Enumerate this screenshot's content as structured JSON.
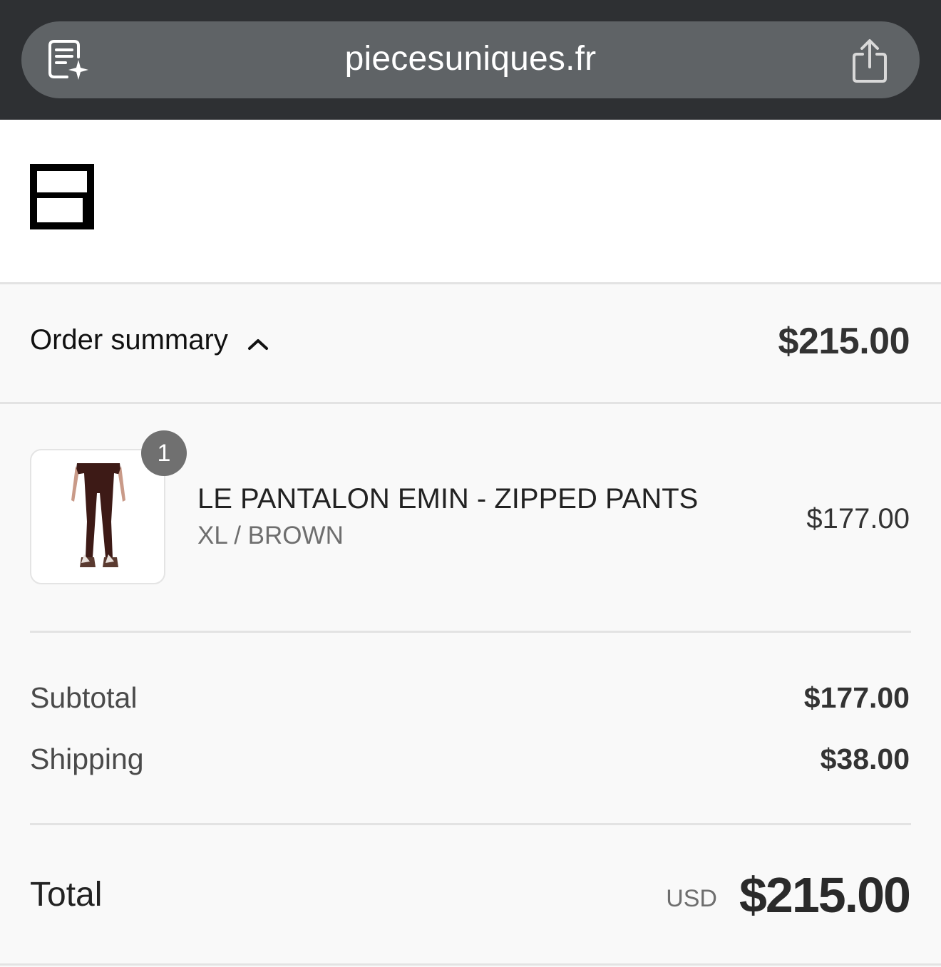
{
  "browser": {
    "url": "piecesuniques.fr",
    "reader_icon": "reader-sparkle-icon",
    "share_icon": "share-icon"
  },
  "store": {
    "logo": "store-logo"
  },
  "summary": {
    "label": "Order summary",
    "toggle_icon": "chevron-up-icon",
    "total": "$215.00"
  },
  "item": {
    "quantity": "1",
    "name": "LE PANTALON EMIN - ZIPPED PANTS",
    "variant": "XL / BROWN",
    "price": "$177.00",
    "image": "brown-pants-thumbnail"
  },
  "lines": [
    {
      "label": "Subtotal",
      "value": "$177.00"
    },
    {
      "label": "Shipping",
      "value": "$38.00"
    }
  ],
  "total": {
    "label": "Total",
    "currency": "USD",
    "value": "$215.00"
  },
  "colors": {
    "browser_bar": "#2e3033",
    "url_pill": "#5f6366",
    "page_bg": "#f9f9f9",
    "badge": "#707070"
  }
}
